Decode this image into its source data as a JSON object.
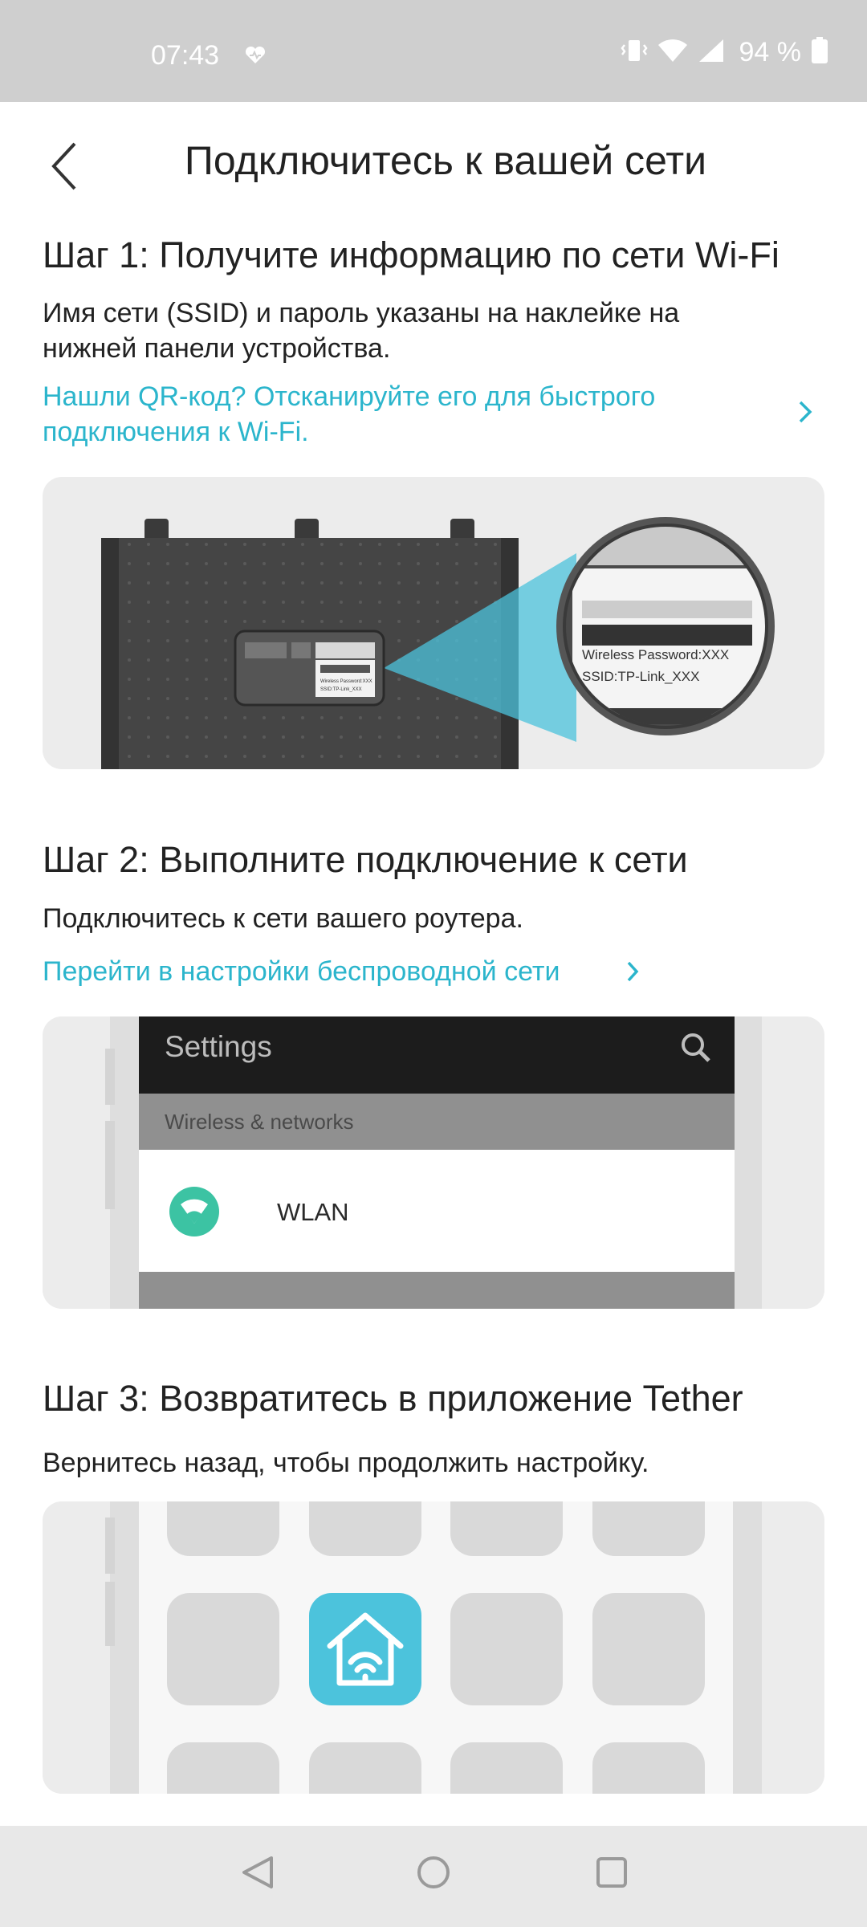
{
  "status": {
    "time": "07:43",
    "battery": "94 %"
  },
  "header": {
    "title": "Подключитесь к вашей сети"
  },
  "step1": {
    "title": "Шаг 1: Получите информацию по сети Wi-Fi",
    "desc_line1": "Имя сети (SSID) и пароль указаны на наклейке на",
    "desc_line2": "нижней панели устройства.",
    "link_line1": "Нашли QR-код? Отсканируйте его для быстрого",
    "link_line2": "подключения к Wi-Fi.",
    "label_password": "Wireless Password:XXX",
    "label_ssid": "SSID:TP-Link_XXX",
    "label_small_password": "Wireless Password:XXX",
    "label_small_ssid": "SSID:TP-Link_XXX"
  },
  "step2": {
    "title": "Шаг 2: Выполните подключение к сети",
    "desc": "Подключитесь к сети вашего роутера.",
    "link": "Перейти в настройки беспроводной сети",
    "settings_title": "Settings",
    "section": "Wireless & networks",
    "wlan": "WLAN"
  },
  "step3": {
    "title": "Шаг 3: Возвратитесь в приложение Tether",
    "desc": "Вернитесь назад, чтобы продолжить настройку."
  },
  "colors": {
    "accent": "#2bb5cc",
    "wifi_green": "#3cc3a3",
    "tether_blue": "#4cc3dc"
  }
}
